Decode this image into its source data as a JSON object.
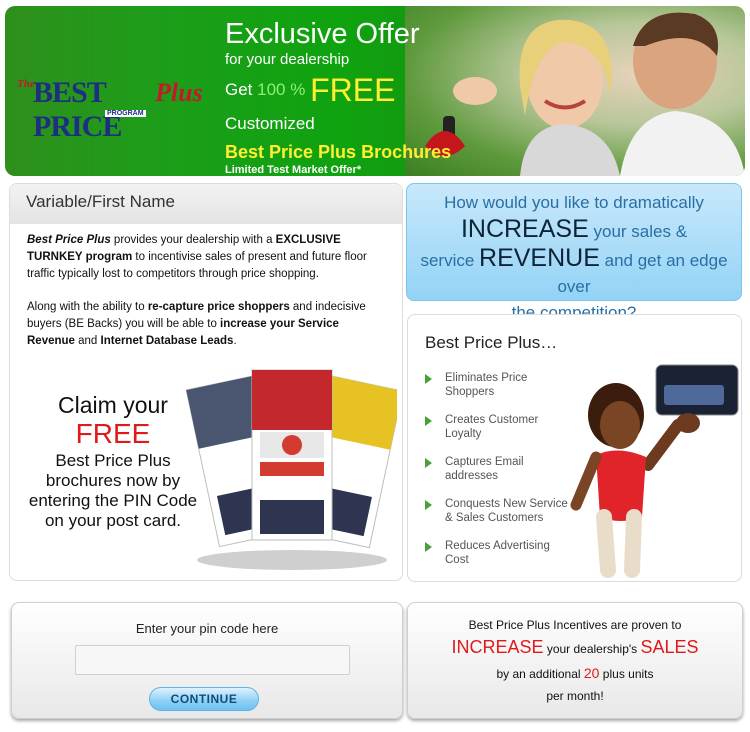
{
  "banner": {
    "logo": {
      "the": "The",
      "best_price": "BEST PRICE",
      "program": "PROGRAM",
      "plus": "Plus"
    },
    "title": "Exclusive Offer",
    "subtitle": "for your dealership",
    "get": "Get",
    "hundred": "100 %",
    "free": "FREE",
    "customized": "Customized",
    "brochures": "Best Price Plus Brochures",
    "limited": "Limited Test Market Offer*"
  },
  "left_panel": {
    "heading": "Variable/First Name",
    "intro": {
      "p1_b1": "Best Price Plus",
      "p1_t1": " provides your dealership with a ",
      "p1_b2": "EXCLUSIVE TURNKEY program",
      "p1_t2": " to incentivise sales of present and future floor traffic typically lost to competitors through price shopping.",
      "p2_t1": "Along with the ability to ",
      "p2_b1": "re-capture price shoppers",
      "p2_t2": " and indecisive buyers (BE Backs) you will be able to ",
      "p2_b2": "increase your Service Revenue",
      "p2_t3": " and ",
      "p2_b3": "Internet Database Leads",
      "p2_t4": "."
    },
    "claim": {
      "line1": "Claim your",
      "line2": "FREE",
      "line3": "Best Price Plus brochures now by entering the PIN Code on your post card."
    }
  },
  "question": {
    "q1": "How would you like to dramatically",
    "increase": "INCREASE",
    "q2": " your sales &",
    "q3": "service ",
    "revenue": "REVENUE",
    "q4": " and get an edge over",
    "q5": "the competition?"
  },
  "right_panel": {
    "heading": "Best Price Plus…",
    "benefits": [
      "Eliminates Price Shoppers",
      "Creates Customer Loyalty",
      "Captures Email addresses",
      "Conquests New Service & Sales Customers",
      "Reduces Advertising Cost"
    ]
  },
  "pin": {
    "label": "Enter your pin code here",
    "value": "",
    "placeholder": "",
    "button": "CONTINUE"
  },
  "incentive": {
    "line1": "Best Price Plus Incentives are proven to",
    "increase": "INCREASE",
    "mid": " your dealership's ",
    "sales": "SALES",
    "pre": "by an additional ",
    "twenty": "20",
    "post": " plus units",
    "line4": "per month!"
  },
  "colors": {
    "banner_green": "#1d9d1a",
    "accent_yellow": "#ffee32",
    "accent_red": "#e01a1a",
    "sky_blue": "#93d3f6",
    "benefit_arrow": "#4aa03a"
  }
}
